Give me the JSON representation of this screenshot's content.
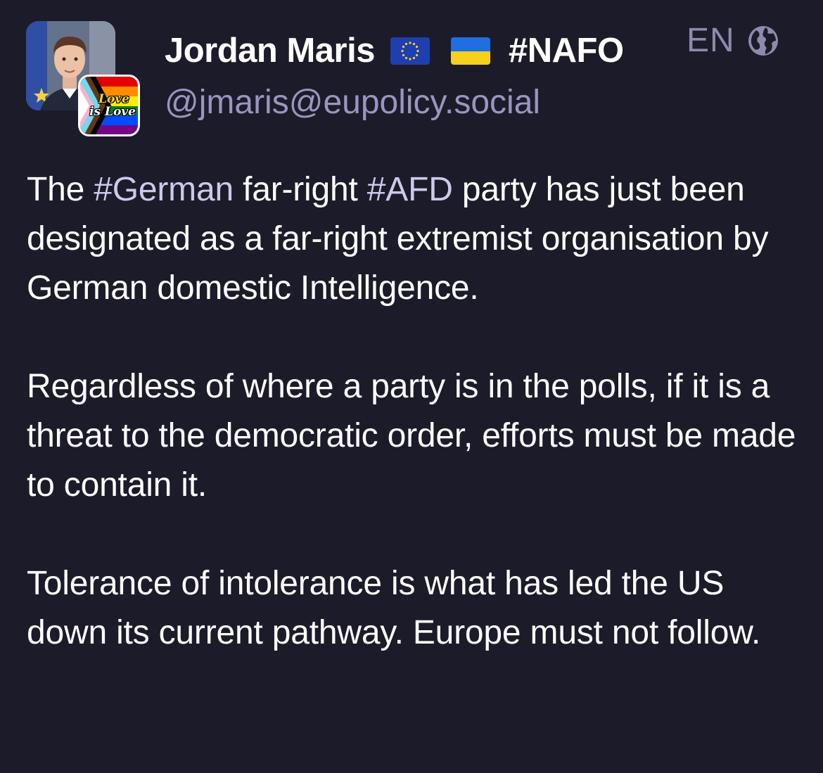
{
  "author": {
    "display_name": "Jordan Maris",
    "hashtag": "#NAFO",
    "handle": "@jmaris@eupolicy.social",
    "avatar_badge": {
      "line1": "Love",
      "line2": "is Love"
    }
  },
  "language": {
    "code": "EN",
    "icon": "globe-icon"
  },
  "post": {
    "p1": {
      "t1": "The ",
      "h1": "#German",
      "t2": " far-right ",
      "h2": "#AFD",
      "t3": " party has just been designated as a far-right extremist organisation by German domestic Intelligence."
    },
    "p2": "Regardless of where a party is in the polls, if it is a threat to the democratic order, efforts must be made to contain it.",
    "p3": "Tolerance of intolerance is what has led the US down its current pathway. Europe must not follow."
  },
  "colors": {
    "background": "#1c1b29",
    "text": "#ffffff",
    "handle": "#9a95c0",
    "hashtag": "#ccc9ec",
    "muted": "#8f8aab"
  }
}
